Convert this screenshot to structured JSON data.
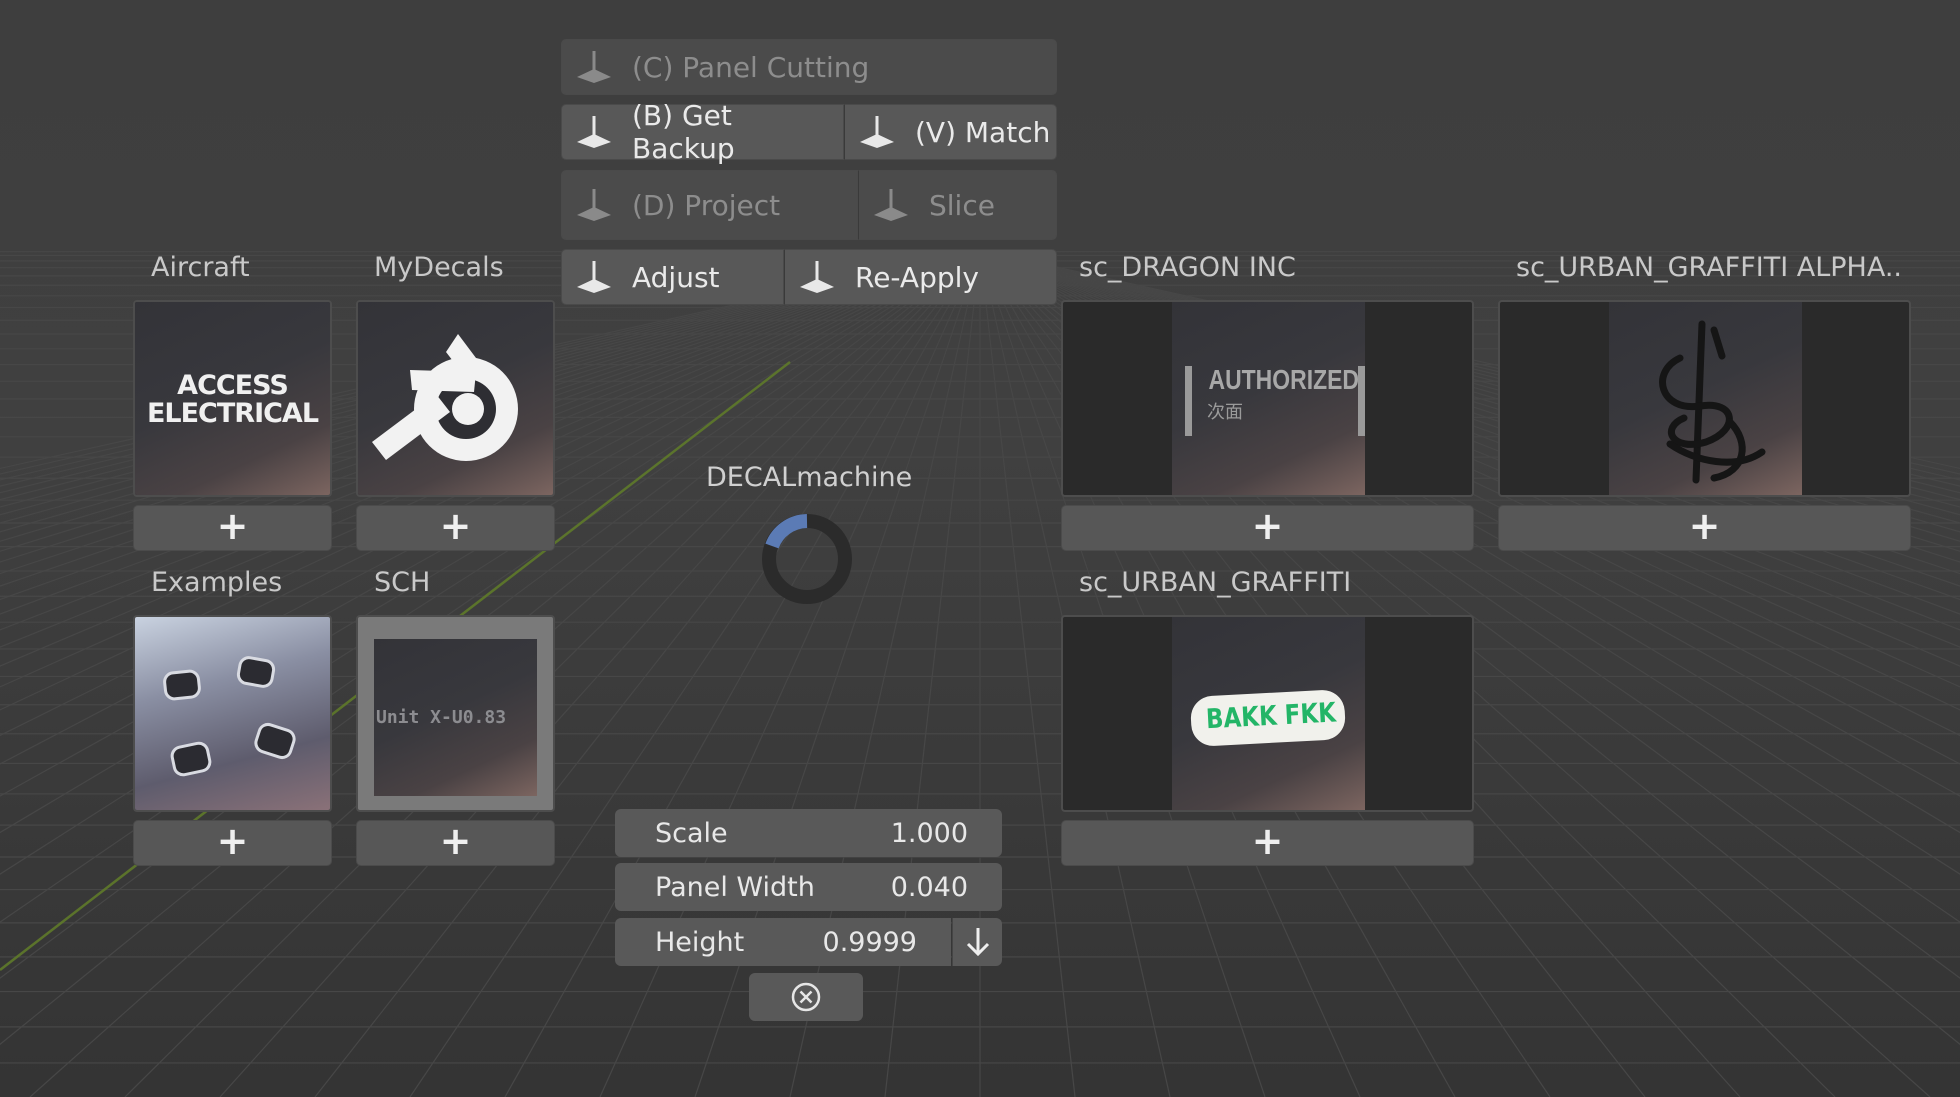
{
  "toolbar": {
    "panel_cutting": "(C) Panel Cutting",
    "get_backup": "(B) Get Backup",
    "match": "(V) Match",
    "project": "(D) Project",
    "slice": "Slice",
    "adjust": "Adjust",
    "reapply": "Re-Apply"
  },
  "center": {
    "title": "DECALmachine"
  },
  "libraries": [
    {
      "title": "Aircraft",
      "thumb_text": "ACCESS\nELECTRICAL",
      "add": "+"
    },
    {
      "title": "MyDecals",
      "add": "+"
    },
    {
      "title": "Examples",
      "add": "+"
    },
    {
      "title": "SCH",
      "thumb_text": "Unit X-U0.83",
      "add": "+"
    },
    {
      "title": "sc_DRAGON INC",
      "thumb_text": "AUTHORIZED",
      "thumb_sub": "次面",
      "add": "+"
    },
    {
      "title": "sc_URBAN_GRAFFITI ALPHA..",
      "add": "+"
    },
    {
      "title": "sc_URBAN_GRAFFITI",
      "thumb_text": "BAKK FKK",
      "add": "+"
    }
  ],
  "fields": {
    "scale_label": "Scale",
    "scale_value": "1.000",
    "panel_width_label": "Panel Width",
    "panel_width_value": "0.040",
    "height_label": "Height",
    "height_value": "0.9999"
  },
  "colors": {
    "accent_blue": "#5b7bb5",
    "grid_line_green": "#5f7a2a"
  }
}
